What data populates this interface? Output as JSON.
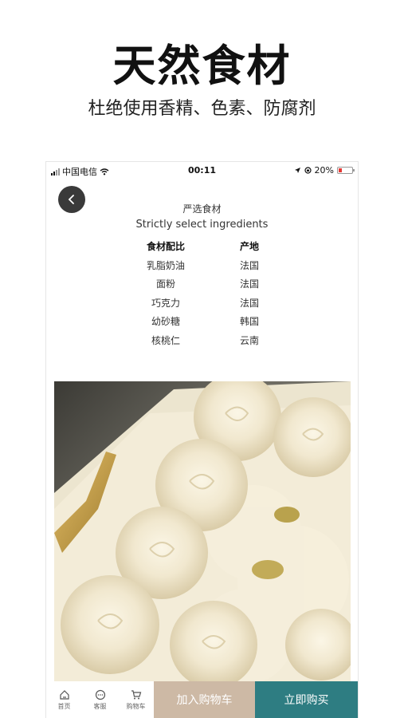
{
  "promo": {
    "headline": "天然食材",
    "subline": "杜绝使用香精、色素、防腐剂"
  },
  "status_bar": {
    "carrier": "中国电信",
    "time": "00:11",
    "battery": "20%"
  },
  "detail": {
    "section_title": "严选食材",
    "section_subtitle": "Strictly select ingredients",
    "table_headers": [
      "食材配比",
      "产地"
    ],
    "rows": [
      [
        "乳脂奶油",
        "法国"
      ],
      [
        "面粉",
        "法国"
      ],
      [
        "巧克力",
        "法国"
      ],
      [
        "幼砂糖",
        "韩国"
      ],
      [
        "核桃仁",
        "云南"
      ]
    ]
  },
  "bottom_bar": {
    "nav": [
      {
        "label": "首页",
        "icon": "home-icon"
      },
      {
        "label": "客服",
        "icon": "chat-icon"
      },
      {
        "label": "购物车",
        "icon": "cart-icon"
      }
    ],
    "add_to_cart": "加入购物车",
    "buy_now": "立即购买"
  },
  "colors": {
    "cart_button": "#cdb9a5",
    "buy_button": "#2e7d82",
    "back_button": "#3a3a3a"
  }
}
